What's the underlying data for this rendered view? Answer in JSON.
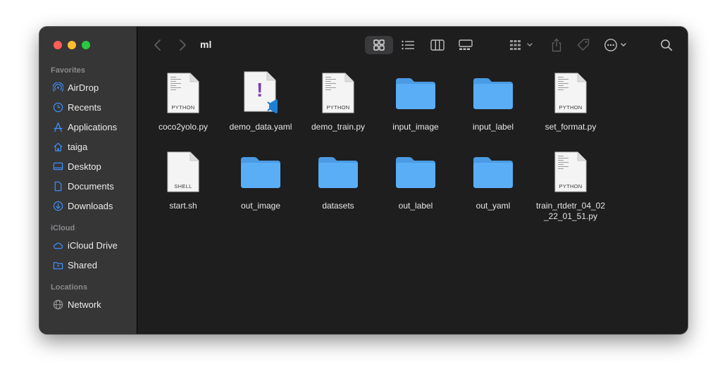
{
  "window": {
    "folder_title": "ml"
  },
  "sidebar": {
    "sections": [
      {
        "title": "Favorites",
        "items": [
          {
            "label": "AirDrop",
            "icon": "airdrop-icon"
          },
          {
            "label": "Recents",
            "icon": "clock-icon"
          },
          {
            "label": "Applications",
            "icon": "applications-icon"
          },
          {
            "label": "taiga",
            "icon": "home-icon"
          },
          {
            "label": "Desktop",
            "icon": "desktop-icon"
          },
          {
            "label": "Documents",
            "icon": "document-icon"
          },
          {
            "label": "Downloads",
            "icon": "download-icon"
          }
        ]
      },
      {
        "title": "iCloud",
        "items": [
          {
            "label": "iCloud Drive",
            "icon": "cloud-icon"
          },
          {
            "label": "Shared",
            "icon": "shared-folder-icon"
          }
        ]
      },
      {
        "title": "Locations",
        "items": [
          {
            "label": "Network",
            "icon": "globe-icon"
          }
        ]
      }
    ]
  },
  "files": [
    {
      "name": "coco2yolo.py",
      "kind": "PYTHON",
      "type": "doc"
    },
    {
      "name": "demo_data.yaml",
      "kind": "",
      "type": "yaml"
    },
    {
      "name": "demo_train.py",
      "kind": "PYTHON",
      "type": "doc"
    },
    {
      "name": "input_image",
      "kind": "",
      "type": "folder"
    },
    {
      "name": "input_label",
      "kind": "",
      "type": "folder"
    },
    {
      "name": "set_format.py",
      "kind": "PYTHON",
      "type": "doc"
    },
    {
      "name": "start.sh",
      "kind": "SHELL",
      "type": "doc"
    },
    {
      "name": "out_image",
      "kind": "",
      "type": "folder"
    },
    {
      "name": "datasets",
      "kind": "",
      "type": "folder"
    },
    {
      "name": "out_label",
      "kind": "",
      "type": "folder"
    },
    {
      "name": "out_yaml",
      "kind": "",
      "type": "folder"
    },
    {
      "name": "train_rtdetr_04_02_22_01_51.py",
      "kind": "PYTHON",
      "type": "doc"
    }
  ],
  "colors": {
    "folder": "#5aaef5",
    "folder_tab": "#4a9be3",
    "sidebar_icon": "#3f8ff7",
    "close": "#fe5f57",
    "minimize": "#febc2e",
    "zoom": "#28c840"
  }
}
